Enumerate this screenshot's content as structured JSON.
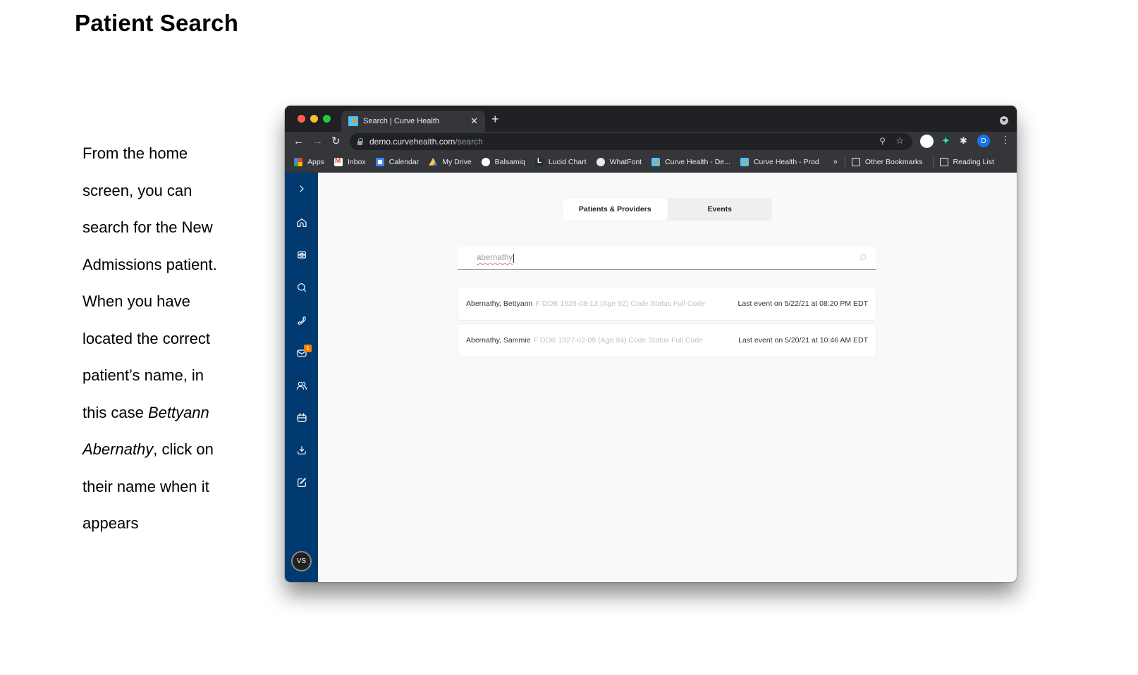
{
  "document": {
    "title": "Patient Search",
    "instructions": {
      "lines": [
        "From the home",
        "screen, you can",
        "search for the New",
        "Admissions patient.",
        "When you have",
        "located the correct",
        "patient’s name, in"
      ],
      "line8_prefix": "this case ",
      "line8_italic": "Bettyann",
      "line9_italic": "Abernathy",
      "line9_suffix": ", click on",
      "line10": "their name when it",
      "line11": "appears"
    }
  },
  "browser": {
    "tab": {
      "title": "Search | Curve Health",
      "close": "✕"
    },
    "new_tab": "+",
    "nav": {
      "back": "←",
      "forward": "→",
      "reload": "↻"
    },
    "url": {
      "host": "demo.curvehealth.com",
      "path": "/search"
    },
    "profile_initial": "D",
    "bookmarks": [
      {
        "label": "Apps",
        "icon": "apps-grid-icon"
      },
      {
        "label": "Inbox",
        "icon": "gmail-icon"
      },
      {
        "label": "Calendar",
        "icon": "calendar-icon"
      },
      {
        "label": "My Drive",
        "icon": "drive-icon"
      },
      {
        "label": "Balsamiq",
        "icon": "smiley-icon"
      },
      {
        "label": "Lucid Chart",
        "icon": "lucid-icon"
      },
      {
        "label": "WhatFont",
        "icon": "globe-icon"
      },
      {
        "label": "Curve Health - De...",
        "icon": "curve-favicon"
      },
      {
        "label": "Curve Health - Prod",
        "icon": "curve-favicon"
      }
    ],
    "bookmarks_more": "»",
    "other_bookmarks": "Other Bookmarks",
    "reading_list": "Reading List"
  },
  "app": {
    "sidebar": {
      "items": [
        {
          "name": "expand",
          "icon": "chevron-right-icon"
        },
        {
          "name": "home",
          "icon": "home-icon"
        },
        {
          "name": "census",
          "icon": "bed-icon"
        },
        {
          "name": "search",
          "icon": "search-icon"
        },
        {
          "name": "calls",
          "icon": "phone-icon"
        },
        {
          "name": "messages",
          "icon": "mail-icon",
          "badge": "1"
        },
        {
          "name": "team",
          "icon": "users-icon"
        },
        {
          "name": "schedule",
          "icon": "calendar-icon"
        },
        {
          "name": "downloads",
          "icon": "download-icon"
        },
        {
          "name": "tasks",
          "icon": "edit-icon"
        }
      ],
      "user_initials": "VS"
    },
    "tabs": [
      {
        "label": "Patients & Providers",
        "active": true
      },
      {
        "label": "Events",
        "active": false
      }
    ],
    "search": {
      "value": "abernathy"
    },
    "results": [
      {
        "name": "Abernathy, Bettyann",
        "meta": "F DOB 1928-08-13 (Age 92) Code Status Full Code",
        "last_event": "Last event on 5/22/21 at 08:20 PM EDT"
      },
      {
        "name": "Abernathy, Sammie",
        "meta": "F DOB 1927-02-09 (Age 94) Code Status Full Code",
        "last_event": "Last event on 5/20/21 at 10:46 AM EDT"
      }
    ],
    "colors": {
      "sidebar": "#003a70",
      "badge": "#f57c00",
      "background": "#f8f9fb"
    }
  }
}
